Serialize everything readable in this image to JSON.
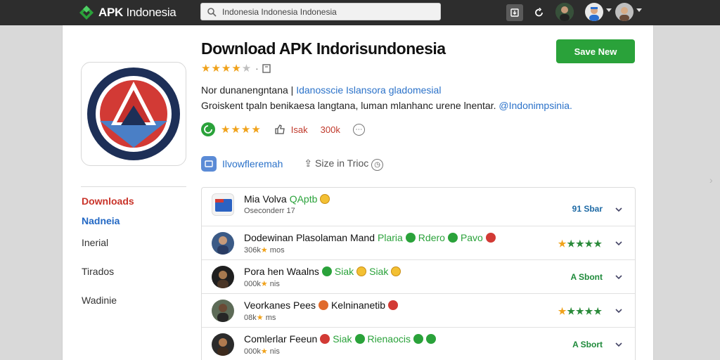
{
  "header": {
    "brand_apk": "APK",
    "brand_rest": "Indonesia",
    "search_value": "Indonesia Indonesia Indonesia"
  },
  "app": {
    "title": "Download APK Indorisundonesia",
    "primary_button": "Save New",
    "rating_stars": 4,
    "rating_max": 5,
    "desc_line1_plain": "Nor dunanengntana |",
    "desc_line1_link": "Idanosscie Islansora gladomesial",
    "desc_line2_plain": "Groiskent tpaln benikaesa langtana, luman mlanhanc urene lnentar.",
    "desc_line2_link": "@Indonimpsinia.",
    "stats_like": "Isak",
    "stats_count": "300k",
    "meta_link": "Ilvowfleremah",
    "meta_share": "Size in Trioc"
  },
  "sidebar": {
    "items": [
      {
        "label": "Downloads"
      },
      {
        "label": "Nadneia"
      },
      {
        "label": "Inerial"
      },
      {
        "label": "Tirados"
      },
      {
        "label": "Wadinie"
      }
    ]
  },
  "list": {
    "rows": [
      {
        "name": "Mia Volva",
        "tag": "QAptb",
        "sub": "Oseconderr 17",
        "right": "91 Sbar"
      },
      {
        "name": "Dodewinan Plasolaman Mand",
        "tag": "Plaria",
        "tag2": "Rdero",
        "tag3": "Pavo",
        "sub": "306k",
        "sub2": "mos",
        "right_stars": 5
      },
      {
        "name": "Pora hen Waalns",
        "tag": "Siak",
        "tag2": "Siak",
        "sub": "000k",
        "sub2": "nis",
        "right": "A Sbont"
      },
      {
        "name": "Veorkanes Pees",
        "tag": "Kelninanetib",
        "sub": "08k",
        "sub2": "ms",
        "right_stars": 5
      },
      {
        "name": "Comlerlar Feeun",
        "tag": "Siak",
        "tag2": "Rienaocis",
        "sub": "000k",
        "sub2": "nis",
        "right": "A Sbort"
      }
    ]
  }
}
